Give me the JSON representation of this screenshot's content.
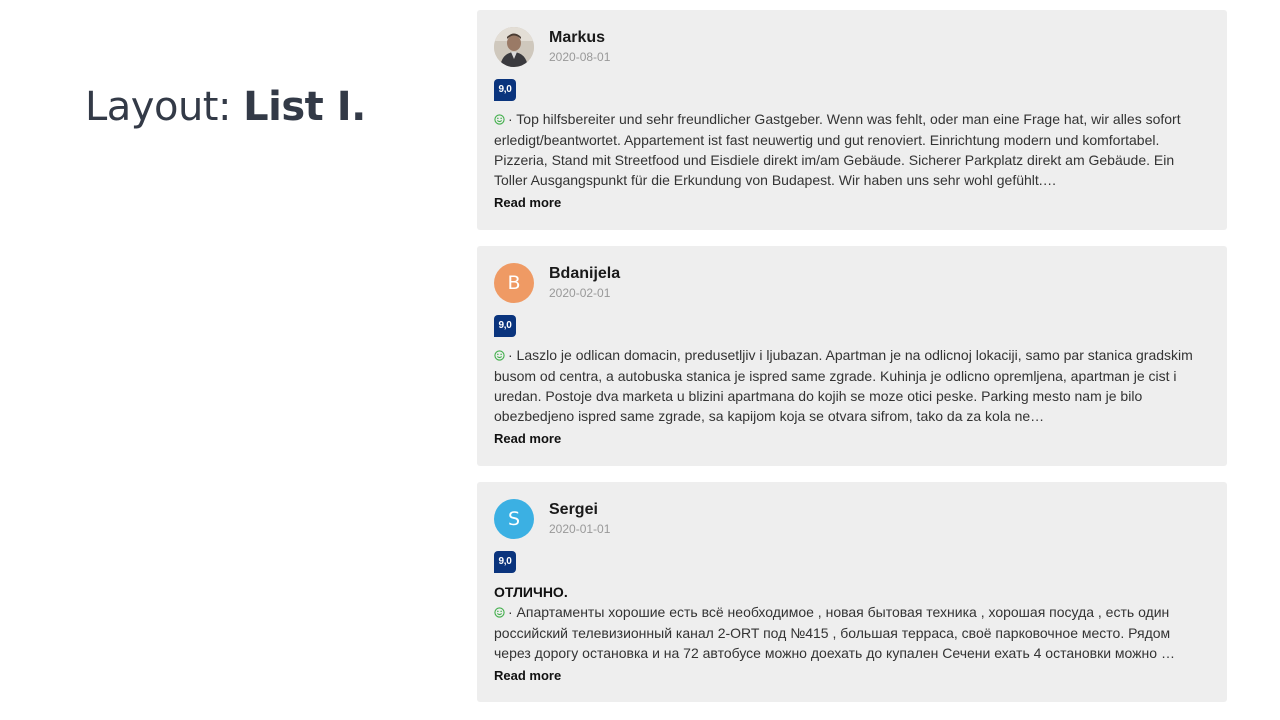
{
  "page": {
    "title_prefix": "Layout: ",
    "title_bold": "List I."
  },
  "colors": {
    "card_background": "#eeeeee",
    "score_badge": "#0a347d",
    "smile_icon": "#3fae49"
  },
  "reviews": [
    {
      "name": "Markus",
      "date": "2020-08-01",
      "score": "9,0",
      "avatar_type": "photo",
      "avatar_letter": "",
      "heading": "",
      "text": "· Top hilfsbereiter und sehr freundlicher Gastgeber. Wenn was fehlt, oder man eine Frage hat, wir alles sofort erledigt/beantwortet. Appartement ist fast neuwertig und gut renoviert. Einrichtung modern und komfortabel. Pizzeria, Stand mit Streetfood und Eisdiele direkt im/am Gebäude. Sicherer Parkplatz direkt am Gebäude. Ein Toller Ausgangspunkt für die Erkundung von Budapest. Wir haben uns sehr wohl gefühlt.…",
      "read_more": "Read more"
    },
    {
      "name": "Bdanijela",
      "date": "2020-02-01",
      "score": "9,0",
      "avatar_type": "letter",
      "avatar_letter": "B",
      "avatar_color": "#ef9a64",
      "heading": "",
      "text": "· Laszlo je odlican domacin, predusetljiv i ljubazan. Apartman je na odlicnoj lokaciji, samo par stanica gradskim busom od centra, a autobuska stanica je ispred same zgrade. Kuhinja je odlicno opremljena, apartman je cist i uredan. Postoje dva marketa u blizini apartmana do kojih se moze otici peske. Parking mesto nam je bilo obezbedjeno ispred same zgrade, sa kapijom koja se otvara sifrom, tako da za kola ne…",
      "read_more": "Read more"
    },
    {
      "name": "Sergei",
      "date": "2020-01-01",
      "score": "9,0",
      "avatar_type": "letter",
      "avatar_letter": "S",
      "avatar_color": "#3bb0e3",
      "heading": "ОТЛИЧНО.",
      "text": "· Апартаменты хорошие есть всё необходимое , новая бытовая техника , хорошая посуда , есть один российский телевизионный канал 2-ORT под №415 , большая терраса, своё парковочное место. Рядом через дорогу остановка и на 72 автобусе можно доехать до купален Сечени ехать 4 остановки можно …",
      "read_more": "Read more"
    }
  ]
}
